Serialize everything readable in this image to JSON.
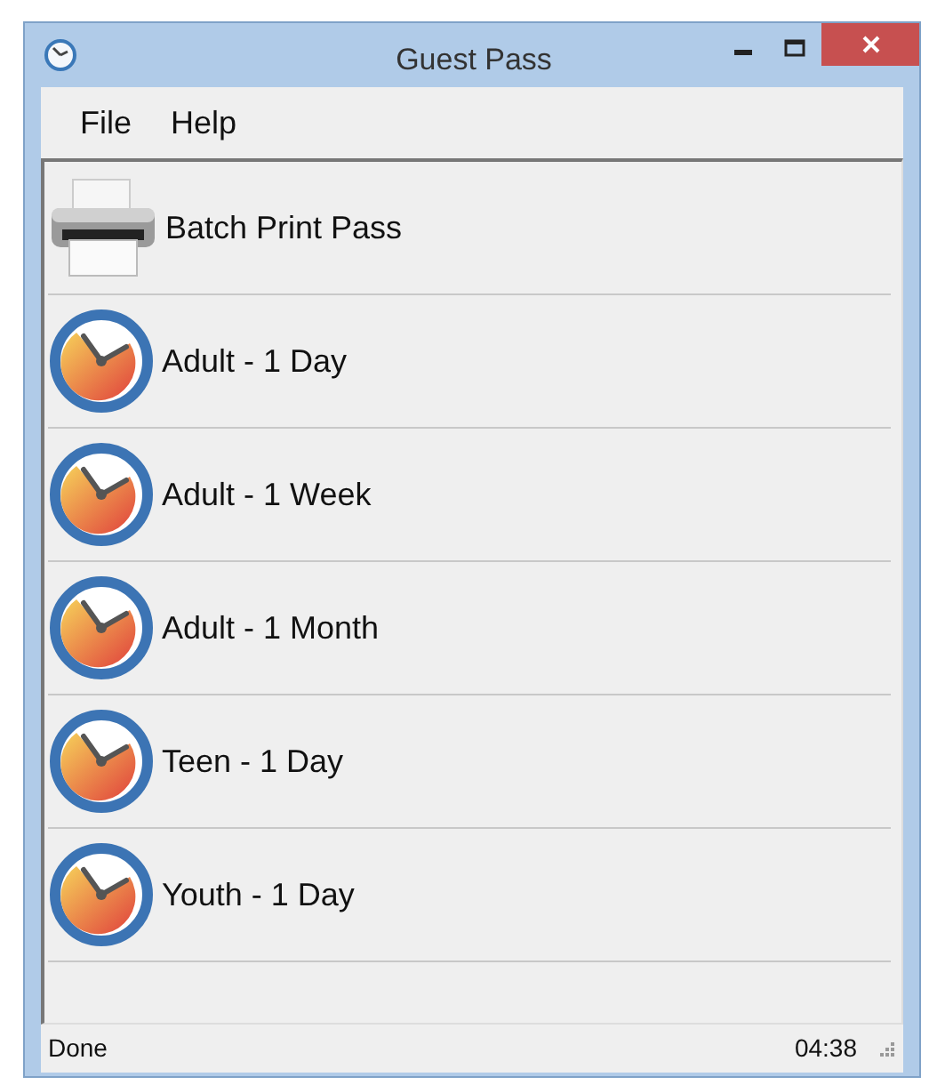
{
  "window": {
    "title": "Guest Pass"
  },
  "menu": [
    "File",
    "Help"
  ],
  "items": [
    {
      "kind": "printer",
      "label": "Batch Print Pass"
    },
    {
      "kind": "clock",
      "label": "Adult - 1 Day"
    },
    {
      "kind": "clock",
      "label": "Adult - 1 Week"
    },
    {
      "kind": "clock",
      "label": "Adult - 1 Month"
    },
    {
      "kind": "clock",
      "label": "Teen - 1 Day"
    },
    {
      "kind": "clock",
      "label": "Youth - 1 Day"
    }
  ],
  "status_bar": {
    "message": "Done",
    "time": "04:38"
  }
}
